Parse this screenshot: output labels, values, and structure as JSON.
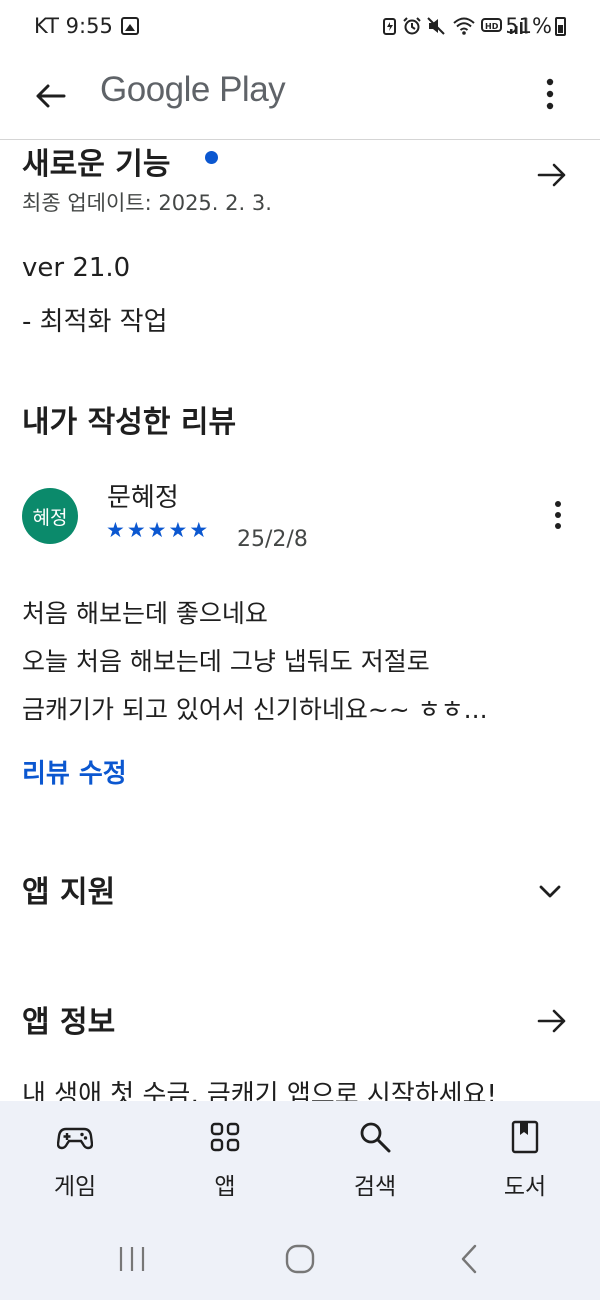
{
  "status_bar": {
    "carrier_time": "KT 9:55",
    "battery": "51%"
  },
  "app_bar": {
    "title": "Google Play"
  },
  "whats_new": {
    "title": "새로운 기능",
    "updated": "최종 업데이트: 2025. 2. 3.",
    "version": "ver 21.0",
    "notes": "- 최적화 작업"
  },
  "my_review": {
    "heading": "내가 작성한 리뷰",
    "avatar_text": "혜정",
    "reviewer": "문혜정",
    "rating": 5,
    "date": "25/2/8",
    "lines": [
      "처음 해보는데 좋으네요",
      "오늘 처음 해보는데 그냥 냅둬도 저절로",
      "금캐기가 되고 있어서 신기하네요~~  ㅎㅎ..."
    ],
    "edit_label": "리뷰 수정"
  },
  "app_support": {
    "title": "앱 지원"
  },
  "app_info": {
    "title": "앱 정보",
    "description": "내 생애 첫 수금, 금캐기 앱으로 시작하세요!"
  },
  "bottom_nav": {
    "items": [
      {
        "label": "게임",
        "icon": "gamepad-icon"
      },
      {
        "label": "앱",
        "icon": "apps-grid-icon"
      },
      {
        "label": "검색",
        "icon": "search-icon"
      },
      {
        "label": "도서",
        "icon": "book-icon"
      }
    ]
  },
  "colors": {
    "accent": "#0b57d0",
    "avatar": "#0b8a6b",
    "nav_background": "#eef1f8"
  }
}
